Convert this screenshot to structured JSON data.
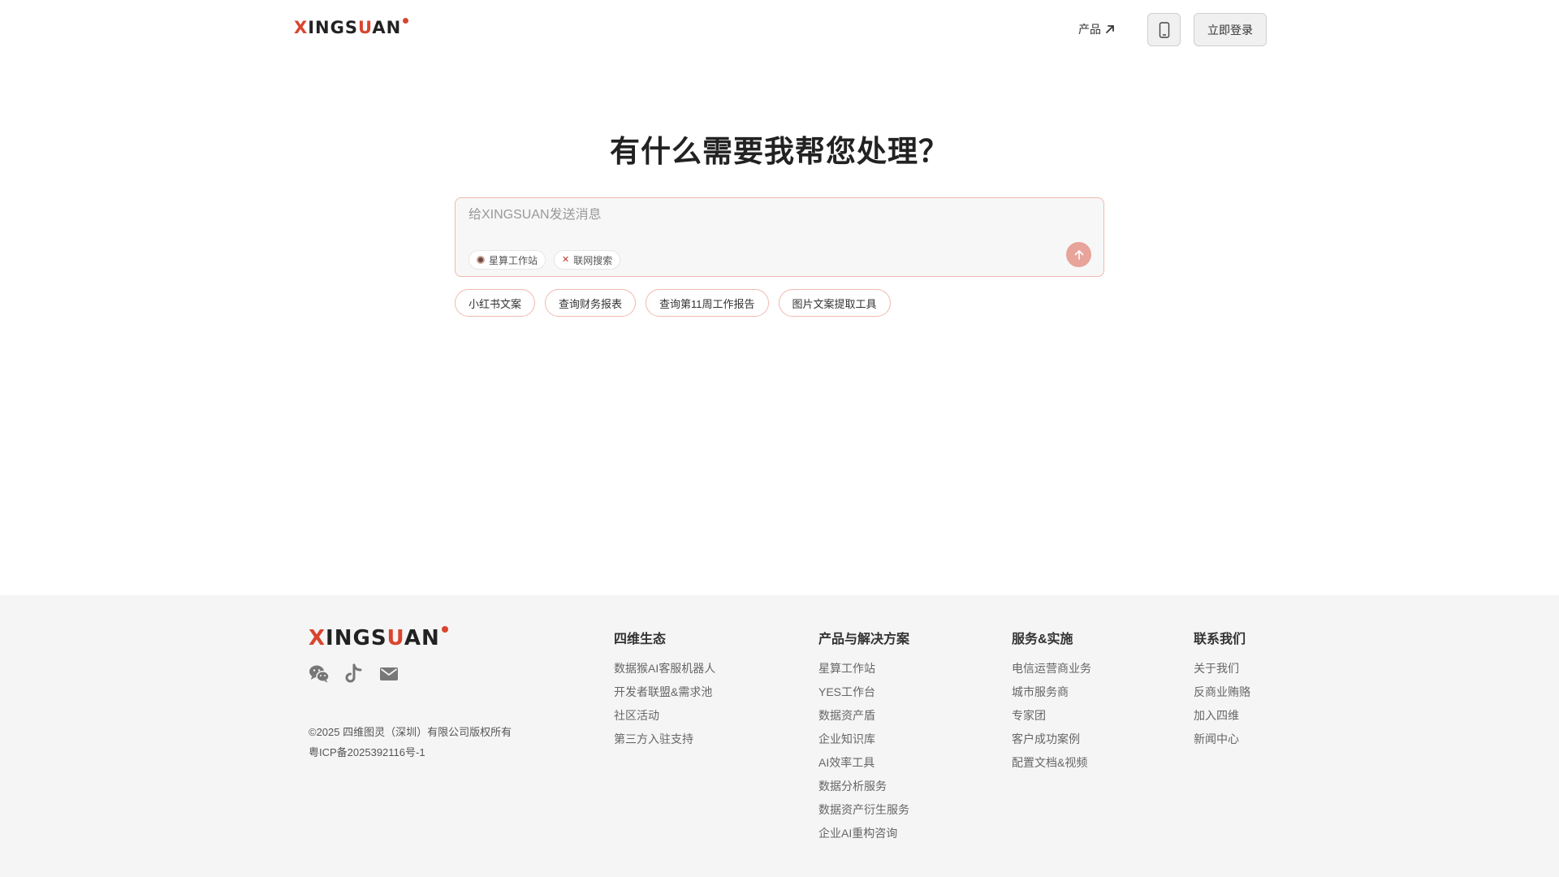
{
  "header": {
    "logo": {
      "part1": "X",
      "part2": "INGS",
      "part3": "U",
      "part4": "AN"
    },
    "nav_products": "产品",
    "login_label": "立即登录"
  },
  "hero": {
    "title": "有什么需要我帮您处理？",
    "input_placeholder": "给XINGSUAN发送消息",
    "tools": [
      "星算工作站",
      "联网搜索"
    ],
    "suggestions": [
      "小红书文案",
      "查询财务报表",
      "查询第11周工作报告",
      "图片文案提取工具"
    ]
  },
  "footer": {
    "logo": {
      "part1": "X",
      "part2": "INGS",
      "part3": "U",
      "part4": "AN"
    },
    "social_icons": [
      "wechat-icon",
      "tiktok-icon",
      "mail-icon"
    ],
    "copyright": "©2025 四维图灵（深圳）有限公司版权所有",
    "icp": "粤ICP备2025392116号-1",
    "columns": [
      {
        "title": "四维生态",
        "links": [
          "数据猴AI客服机器人",
          "开发者联盟&需求池",
          "社区活动",
          "第三方入驻支持"
        ]
      },
      {
        "title": "产品与解决方案",
        "links": [
          "星算工作站",
          "YES工作台",
          "数据资产盾",
          "企业知识库",
          "AI效率工具",
          "数据分析服务",
          "数据资产衍生服务",
          "企业AI重构咨询"
        ]
      },
      {
        "title": "服务&实施",
        "links": [
          "电信运营商业务",
          "城市服务商",
          "专家团",
          "客户成功案例",
          "配置文档&视频"
        ]
      },
      {
        "title": "联系我们",
        "links": [
          "关于我们",
          "反商业贿赂",
          "加入四维",
          "新闻中心"
        ]
      }
    ]
  },
  "colors": {
    "brand_red": "#d9452f",
    "accent_border": "#f0b9b0",
    "send_button": "#e8a39a",
    "footer_bg": "#f5f5f5"
  }
}
